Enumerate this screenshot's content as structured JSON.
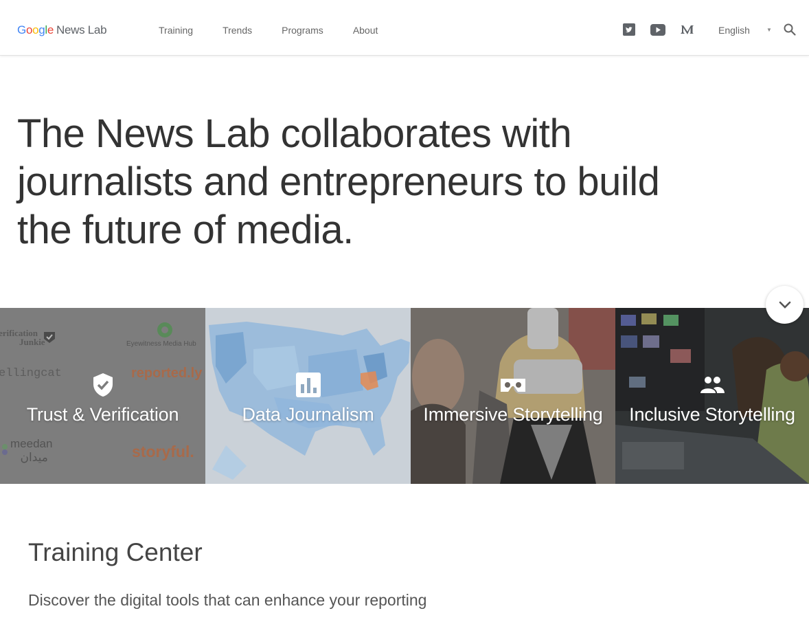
{
  "header": {
    "logo": {
      "google": [
        "G",
        "o",
        "o",
        "g",
        "l",
        "e"
      ],
      "rest": "News Lab"
    },
    "nav": [
      {
        "label": "Training"
      },
      {
        "label": "Trends"
      },
      {
        "label": "Programs"
      },
      {
        "label": "About"
      }
    ],
    "social": [
      "twitter-icon",
      "youtube-icon",
      "medium-icon"
    ],
    "language": "English"
  },
  "hero": {
    "lines": [
      "The News Lab collaborates with",
      "journalists and entrepreneurs to build",
      "the future of media."
    ]
  },
  "tiles": [
    {
      "label": "Trust & Verification",
      "icon": "shield-check-icon",
      "logos": [
        "erification",
        "Junkie",
        "Eyewitness Media Hub",
        "ellingcat",
        "reported.ly",
        "meedan",
        "ميدان",
        "storyful."
      ]
    },
    {
      "label": "Data Journalism",
      "icon": "bar-chart-icon"
    },
    {
      "label": "Immersive Storytelling",
      "icon": "cardboard-vr-icon"
    },
    {
      "label": "Inclusive Storytelling",
      "icon": "people-icon"
    }
  ],
  "training_center": {
    "title": "Training Center",
    "subtitle": "Discover the digital tools that can enhance your reporting"
  },
  "colors": {
    "google_blue": "#4285F4",
    "google_red": "#EA4335",
    "google_yellow": "#FBBC05",
    "google_green": "#34A853",
    "accent_orange": "#e07a3c"
  }
}
